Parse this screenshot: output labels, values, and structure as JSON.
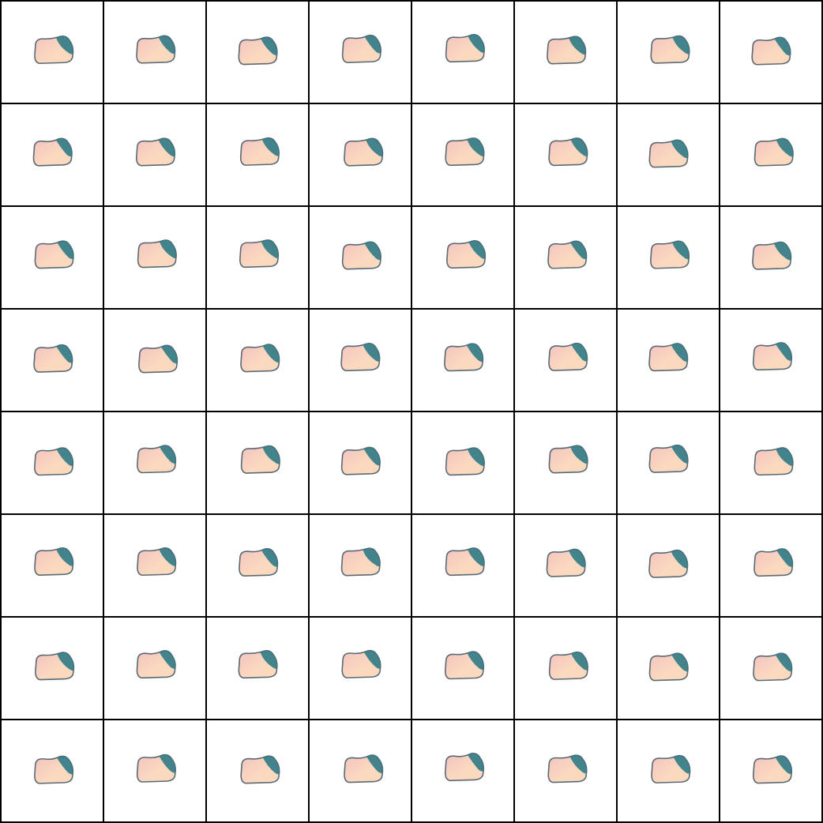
{
  "grid": {
    "rows": 8,
    "cols": 8
  },
  "colors": {
    "border": "#000000",
    "background": "#ffffff",
    "body_light": "#fbd9bf",
    "body_pink": "#f4c3c0",
    "accent_teal": "#2f7a86",
    "outline": "#5a6a75"
  }
}
